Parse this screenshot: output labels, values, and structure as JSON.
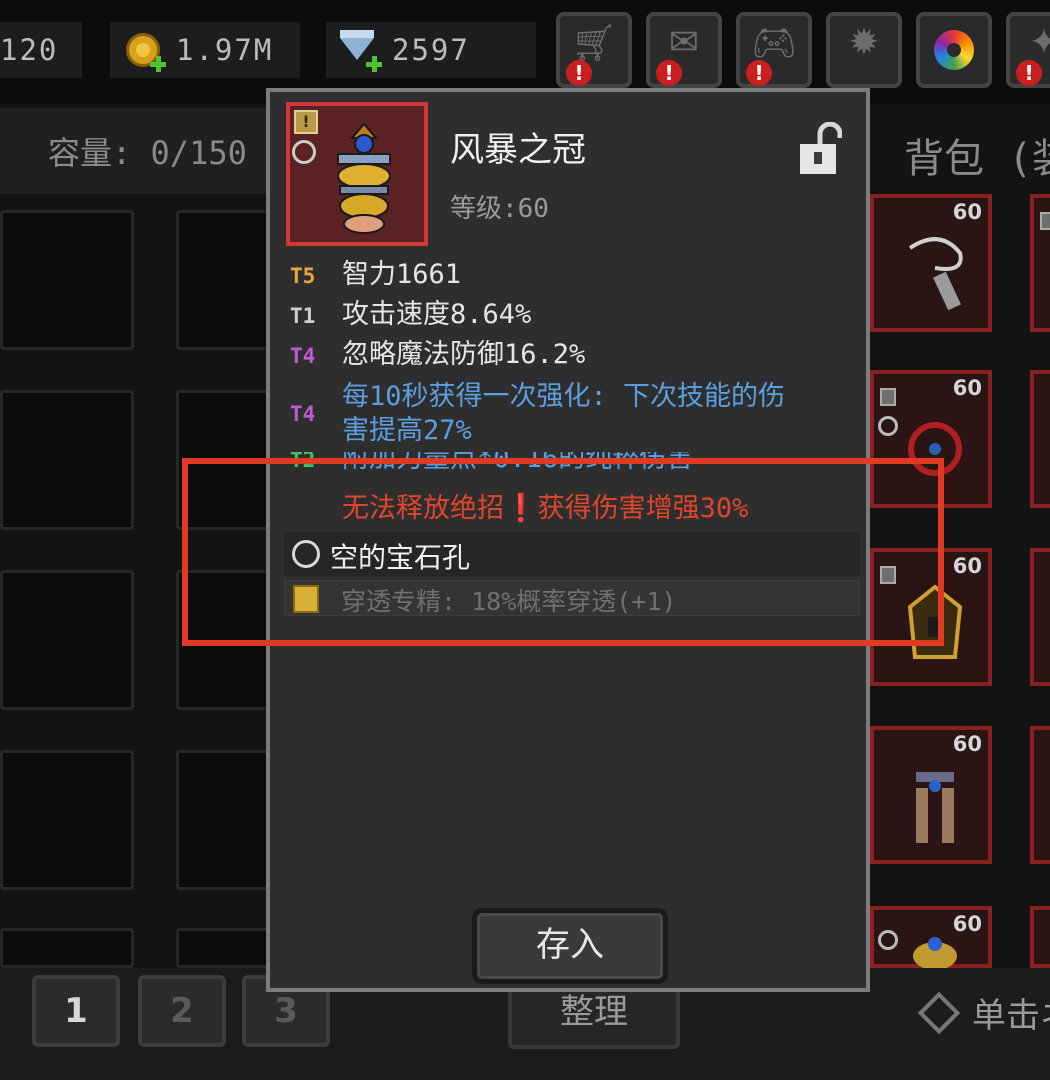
{
  "resources": {
    "energy": "120",
    "gold": "1.97M",
    "gems": "2597"
  },
  "toolbar": {
    "buttons": [
      {
        "name": "shop",
        "icon": "shopping-cart-icon",
        "alert": "!"
      },
      {
        "name": "mail",
        "icon": "mail-icon",
        "alert": "!"
      },
      {
        "name": "gamepad",
        "icon": "gamepad-icon",
        "alert": "!"
      },
      {
        "name": "settings",
        "icon": "gear-icon",
        "alert": ""
      },
      {
        "name": "color",
        "icon": "color-wheel-icon",
        "alert": ""
      },
      {
        "name": "effects",
        "icon": "sparkle-icon",
        "alert": "!"
      }
    ]
  },
  "storage": {
    "capacity_label": "容量: 0/150"
  },
  "bag": {
    "title": "背包 (装",
    "slot_levels": [
      "60",
      "60",
      "60",
      "60",
      "60"
    ]
  },
  "item": {
    "name": "风暴之冠",
    "level": "等级:60",
    "stats": [
      {
        "tier": "T5",
        "text": "智力1661"
      },
      {
        "tier": "T1",
        "text": "攻击速度8.64%"
      },
      {
        "tier": "T4",
        "text": "忽略魔法防御16.2%"
      },
      {
        "tier": "T4",
        "text": "每10秒获得一次强化: 下次技能的伤",
        "text2": "害提高27%"
      },
      {
        "tier": "T2",
        "text": "附加力量点*0.16的纯粹伤害"
      }
    ],
    "special": "无法释放绝招❗获得伤害增强30%",
    "socket": "空的宝石孔",
    "enchant": "穿透专精: 18%概率穿透(+1)",
    "store_button": "存入"
  },
  "footer": {
    "pages": [
      "1",
      "2",
      "3"
    ],
    "sort_button": "整理",
    "hint": "单击ネ"
  },
  "colors": {
    "highlight": "#e03a22",
    "tier5": "#e8a83a",
    "tier4": "#c058d8",
    "tier2": "#3ec46a",
    "affix_blue": "#5c9fe0",
    "special_red": "#e2452c"
  }
}
